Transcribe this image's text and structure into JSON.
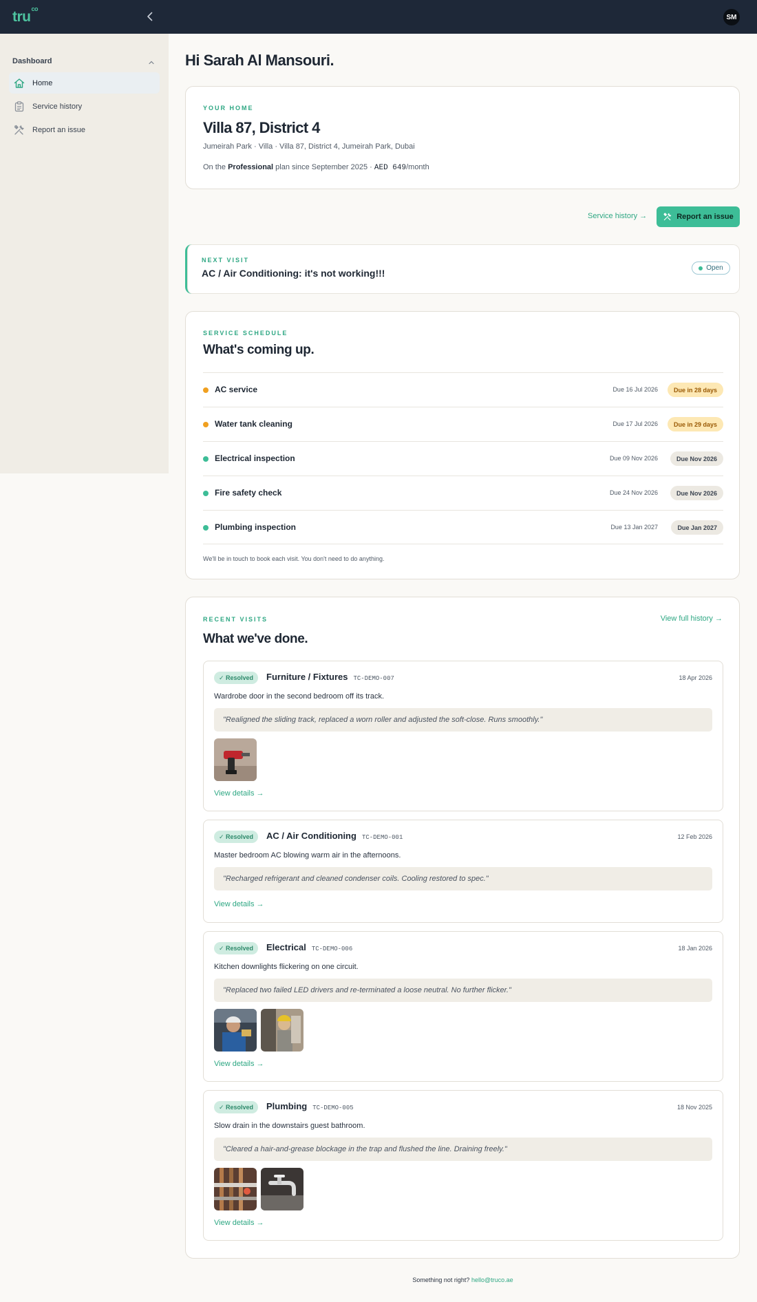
{
  "brand": {
    "logo": "tru",
    "logo_sup": "co",
    "accent": "#3dbd97",
    "header_bg": "#1e2838"
  },
  "header": {
    "avatar_initials": "SM"
  },
  "sidebar": {
    "section_label": "Dashboard",
    "items": [
      {
        "label": "Home",
        "icon": "home-icon",
        "active": true
      },
      {
        "label": "Service history",
        "icon": "clipboard-icon",
        "active": false
      },
      {
        "label": "Report an issue",
        "icon": "tools-icon",
        "active": false
      }
    ]
  },
  "greeting": "Hi Sarah Al Mansouri.",
  "home": {
    "eyebrow": "YOUR HOME",
    "title": "Villa 87, District 4",
    "address": "Jumeirah Park · Villa · Villa 87, District 4, Jumeirah Park, Dubai",
    "plan_prefix": "On the ",
    "plan_name": "Professional",
    "plan_mid": " plan since September 2025 · ",
    "plan_price": "AED 649",
    "plan_suffix": "/month"
  },
  "actions": {
    "history_link": "Service history →",
    "report_button": "Report an issue"
  },
  "next_visit": {
    "eyebrow": "NEXT VISIT",
    "title": "AC / Air Conditioning: it's not working!!!",
    "status": "Open"
  },
  "schedule": {
    "eyebrow": "SERVICE SCHEDULE",
    "title": "What's coming up.",
    "items": [
      {
        "name": "AC service",
        "due": "Due 16 Jul 2026",
        "badge": "Due in 28 days",
        "tone": "warn",
        "dot": "#f0a020"
      },
      {
        "name": "Water tank cleaning",
        "due": "Due 17 Jul 2026",
        "badge": "Due in 29 days",
        "tone": "warn",
        "dot": "#f0a020"
      },
      {
        "name": "Electrical inspection",
        "due": "Due 09 Nov 2026",
        "badge": "Due Nov 2026",
        "tone": "neutral",
        "dot": "#3dbd97"
      },
      {
        "name": "Fire safety check",
        "due": "Due 24 Nov 2026",
        "badge": "Due Nov 2026",
        "tone": "neutral",
        "dot": "#3dbd97"
      },
      {
        "name": "Plumbing inspection",
        "due": "Due 13 Jan 2027",
        "badge": "Due Jan 2027",
        "tone": "neutral",
        "dot": "#3dbd97"
      }
    ],
    "note": "We'll be in touch to book each visit. You don't need to do anything."
  },
  "recent": {
    "eyebrow": "RECENT VISITS",
    "title": "What we've done.",
    "history_link": "View full history →",
    "visits": [
      {
        "status": "✓ Resolved",
        "category": "Furniture / Fixtures",
        "id": "TC-DEMO-007",
        "date": "18 Apr 2026",
        "description": "Wardrobe door in the second bedroom off its track.",
        "note": "\"Realigned the sliding track, replaced a worn roller and adjusted the soft-close. Runs smoothly.\"",
        "link": "View details →"
      },
      {
        "status": "✓ Resolved",
        "category": "AC / Air Conditioning",
        "id": "TC-DEMO-001",
        "date": "12 Feb 2026",
        "description": "Master bedroom AC blowing warm air in the afternoons.",
        "note": "\"Recharged refrigerant and cleaned condenser coils. Cooling restored to spec.\"",
        "link": "View details →"
      },
      {
        "status": "✓ Resolved",
        "category": "Electrical",
        "id": "TC-DEMO-006",
        "date": "18 Jan 2026",
        "description": "Kitchen downlights flickering on one circuit.",
        "note": "\"Replaced two failed LED drivers and re-terminated a loose neutral. No further flicker.\"",
        "link": "View details →"
      },
      {
        "status": "✓ Resolved",
        "category": "Plumbing",
        "id": "TC-DEMO-005",
        "date": "18 Nov 2025",
        "description": "Slow drain in the downstairs guest bathroom.",
        "note": "\"Cleared a hair-and-grease blockage in the trap and flushed the line. Draining freely.\"",
        "link": "View details →"
      }
    ]
  },
  "footer": {
    "text": "Something not right? ",
    "email": "hello@truco.ae"
  }
}
